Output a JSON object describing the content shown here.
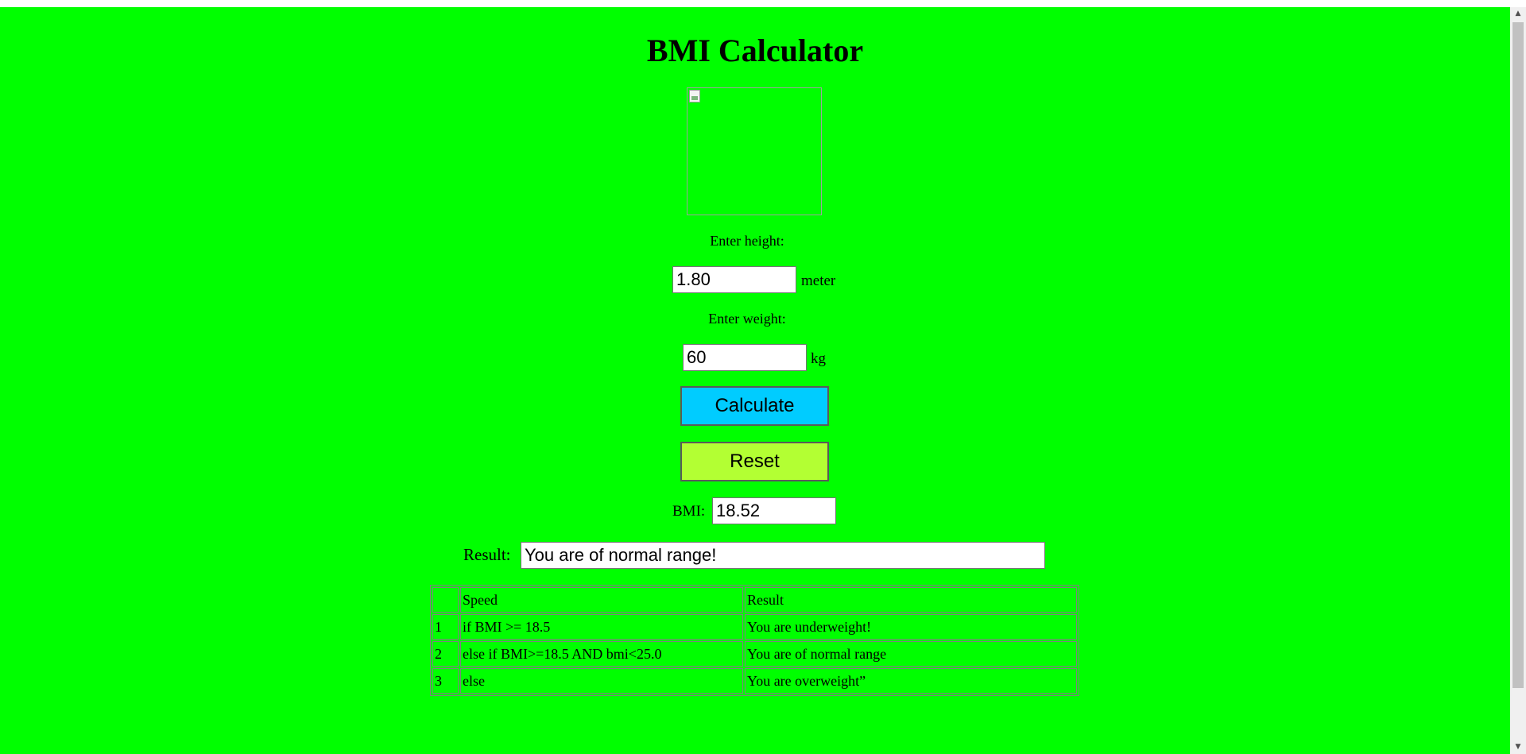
{
  "page": {
    "title": "BMI Calculator",
    "background_color": "#00ff00"
  },
  "form": {
    "height_label": "Enter height:",
    "height_value": "1.80",
    "height_unit": "meter",
    "weight_label": "Enter weight:",
    "weight_value": "60",
    "weight_unit": "kg",
    "calculate_label": "Calculate",
    "calculate_color": "#00ccff",
    "reset_label": "Reset",
    "reset_color": "#b3ff33",
    "bmi_label": "BMI:",
    "bmi_value": "18.52",
    "result_label": "Result:",
    "result_value": "You are of normal range!"
  },
  "table": {
    "headers": [
      "",
      "Speed",
      "Result"
    ],
    "rows": [
      [
        "1",
        "if BMI >= 18.5",
        "You are underweight!"
      ],
      [
        "2",
        "else if BMI>=18.5 AND bmi<25.0",
        "You are of normal range"
      ],
      [
        "3",
        "else",
        "You are overweight”"
      ]
    ]
  },
  "icons": {
    "image": "broken-image-icon",
    "scroll_up": "scroll-up-arrow-icon",
    "scroll_down": "scroll-down-arrow-icon"
  }
}
